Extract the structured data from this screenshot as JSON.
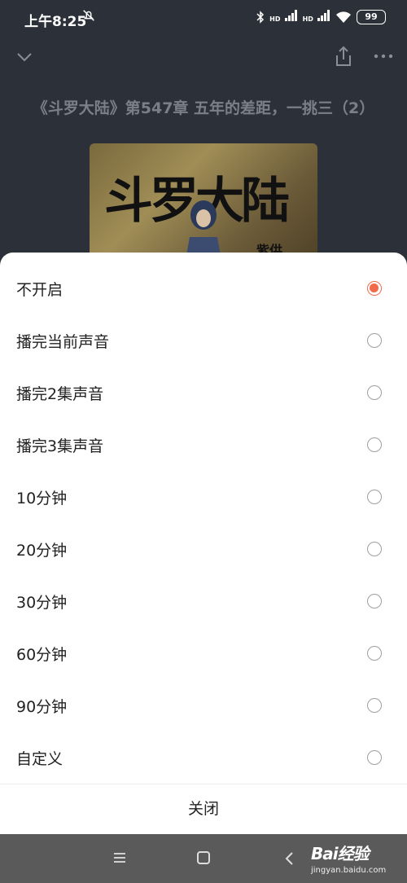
{
  "status_bar": {
    "time": "上午8:25",
    "battery": "99",
    "icons": [
      "mute-alarm-icon",
      "bluetooth-icon",
      "signal-hd-icon",
      "signal-hd-icon",
      "wifi-icon",
      "battery-icon"
    ],
    "hd_label": "HD"
  },
  "player": {
    "chapter_title": "《斗罗大陆》第547章 五年的差距，一挑三（2）",
    "cover_text": "斗罗大陆",
    "cover_author": "紫供",
    "icons": [
      "collapse-chevron-icon",
      "share-icon",
      "more-icon"
    ]
  },
  "timer_sheet": {
    "selected_index": 0,
    "accent_color": "#f26a4a",
    "options": [
      {
        "label": "不开启"
      },
      {
        "label": "播完当前声音"
      },
      {
        "label": "播完2集声音"
      },
      {
        "label": "播完3集声音"
      },
      {
        "label": "10分钟"
      },
      {
        "label": "20分钟"
      },
      {
        "label": "30分钟"
      },
      {
        "label": "60分钟"
      },
      {
        "label": "90分钟"
      },
      {
        "label": "自定义"
      }
    ],
    "close_label": "关闭"
  },
  "nav_bar": {
    "icons": [
      "menu-icon",
      "home-icon",
      "back-icon"
    ]
  },
  "watermark": {
    "main": "Bai经验",
    "sub": "jingyan.baidu.com"
  }
}
